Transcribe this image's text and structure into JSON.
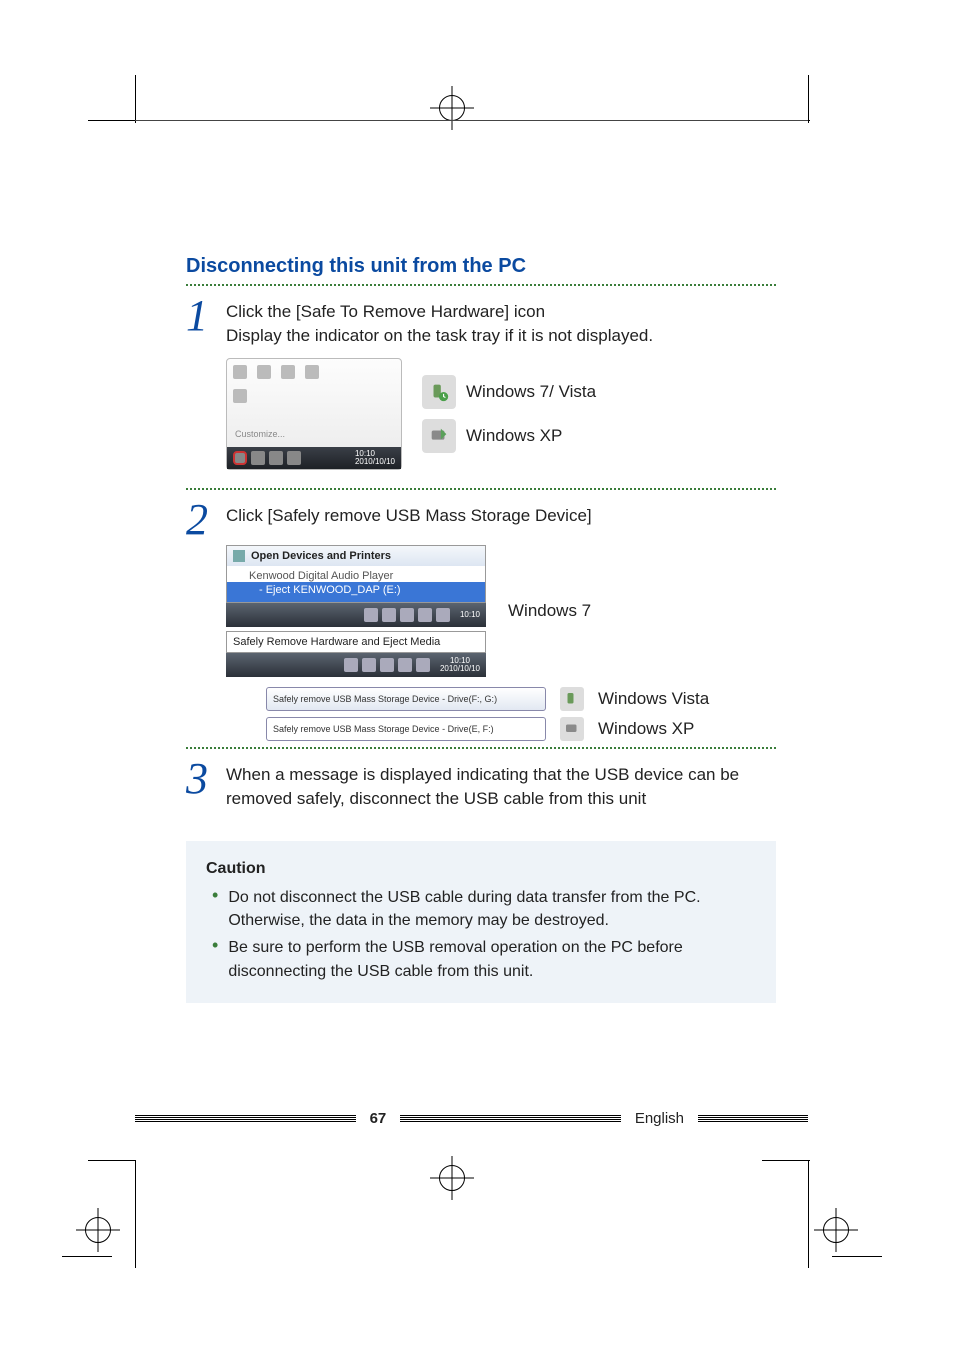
{
  "heading": "Disconnecting this unit from the PC",
  "step1": {
    "num": "1",
    "line1": "Click the [Safe To Remove Hardware] icon",
    "line2": "Display the indicator on the task tray if it is not displayed.",
    "tray_customize": "Customize...",
    "tray_time": "10:10",
    "tray_date": "2010/10/10",
    "os_win7vista": "Windows 7/ Vista",
    "os_xp": "Windows XP"
  },
  "step2": {
    "num": "2",
    "line1": "Click [Safely remove USB Mass Storage Device]",
    "menu_header": "Open Devices and Printers",
    "menu_row1": "Kenwood Digital Audio Player",
    "menu_row2": "- Eject KENWOOD_DAP (E:)",
    "tb_time1": "10:10",
    "eject_label": "Safely Remove Hardware and Eject Media",
    "tb_time2": "10:10",
    "tb_date2": "2010/10/10",
    "label_win7": "Windows 7",
    "balloon_vista": "Safely remove USB Mass Storage Device - Drive(F:, G:)",
    "label_vista": "Windows Vista",
    "balloon_xp": "Safely remove USB Mass Storage Device - Drive(E, F:)",
    "label_xp": "Windows XP"
  },
  "step3": {
    "num": "3",
    "text": "When a message is displayed indicating that the USB device can be removed safely, disconnect the USB cable from this unit"
  },
  "caution": {
    "title": "Caution",
    "item1": "Do not disconnect the USB cable during data transfer from the PC. Otherwise, the data in the memory may be destroyed.",
    "item2": "Be sure to perform the USB removal operation on the PC before disconnecting the USB cable from this unit."
  },
  "footer": {
    "page": "67",
    "lang": "English"
  }
}
